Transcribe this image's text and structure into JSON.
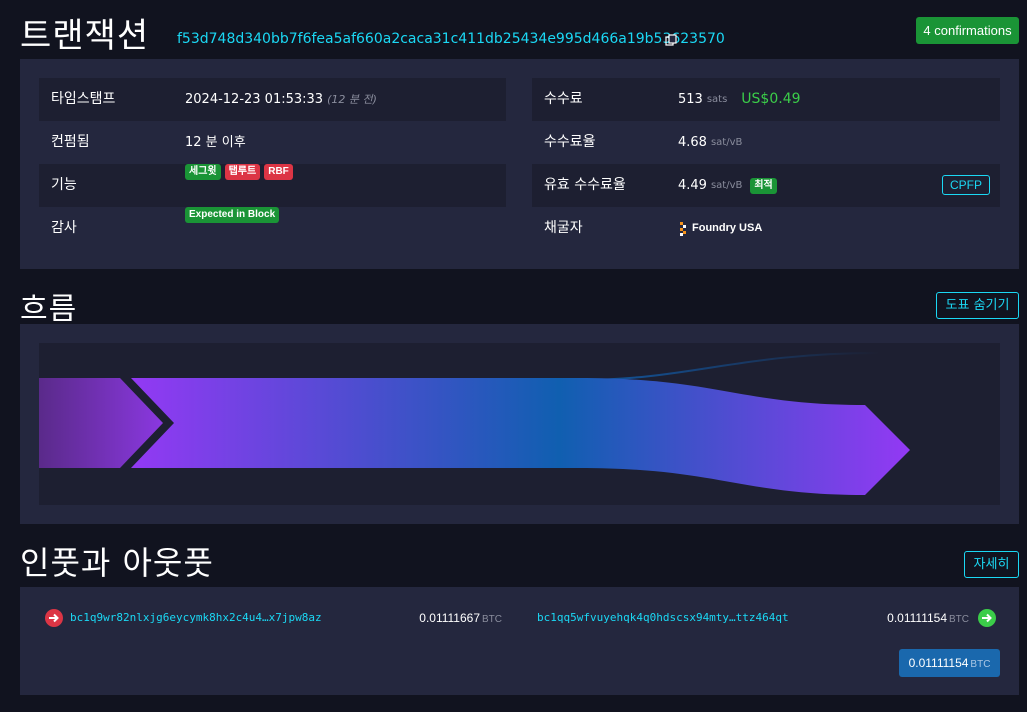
{
  "header": {
    "title": "트랜잭션",
    "txid": "f53d748d340bb7f6fea5af660a2caca31c411db25434e995d466a19b53623570",
    "confirmations": "4 confirmations"
  },
  "details": {
    "timestamp_label": "타임스탬프",
    "timestamp_value": "2024-12-23 01:53:33",
    "timestamp_ago": "(12 분 전)",
    "confirmed_label": "컨펌됨",
    "confirmed_value": "12 분 이후",
    "features_label": "기능",
    "features": [
      "세그윗",
      "탭루트",
      "RBF"
    ],
    "audit_label": "감사",
    "audit_badge": "Expected in Block",
    "fee_label": "수수료",
    "fee_value": "513",
    "fee_unit": "sats",
    "fee_usd": "US$0.49",
    "feerate_label": "수수료율",
    "feerate_value": "4.68",
    "feerate_unit": "sat/vB",
    "eff_feerate_label": "유효 수수료율",
    "eff_feerate_value": "4.49",
    "eff_feerate_unit": "sat/vB",
    "eff_badge": "최적",
    "cpfp_label": "CPFP",
    "miner_label": "채굴자",
    "miner_value": "Foundry USA"
  },
  "flow": {
    "title": "흐름",
    "hide_button": "도표 숨기기"
  },
  "io": {
    "title": "인풋과 아웃풋",
    "details_button": "자세히",
    "input_address": "bc1q9wr82nlxjg6eycymk8hx2c4u4…x7jpw8az",
    "input_amount": "0.01111667",
    "output_address": "bc1qq5wfvuyehqk4q0hdscsx94mty…ttz464qt",
    "output_amount": "0.01111154",
    "unit": "BTC",
    "total_amount": "0.01111154"
  },
  "colors": {
    "accent": "#1bd8f4",
    "success": "#1a9436",
    "danger": "#dc3545",
    "flow_start": "#9339f4",
    "flow_end": "#105fb0"
  }
}
